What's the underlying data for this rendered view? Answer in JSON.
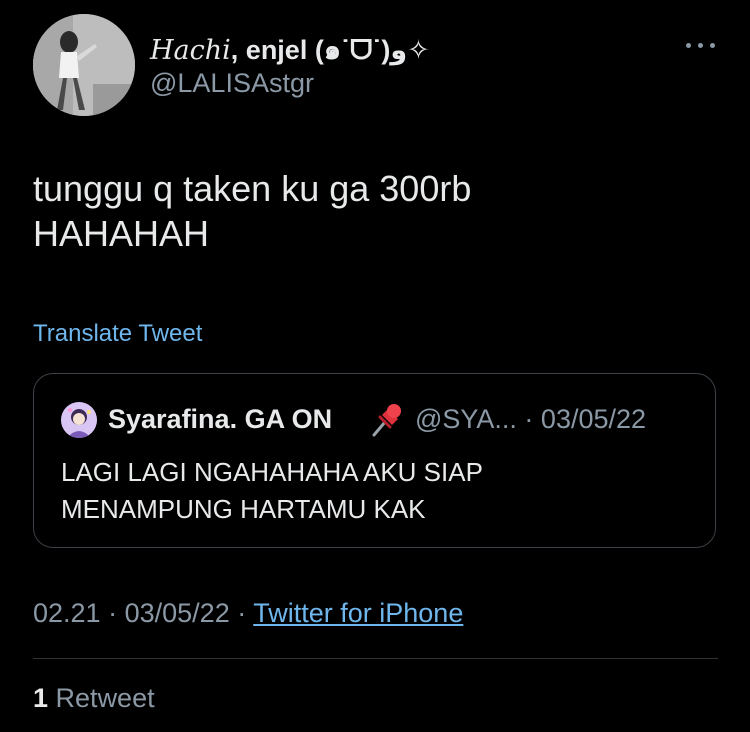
{
  "author": {
    "display_name_fancy": "𝐻𝑎𝑐ℎ𝑖",
    "display_name_rest": ", enjel (๑˙ᗜ˙)و✧",
    "handle": "@LALISAstgr",
    "avatar_icon": "profile-photo"
  },
  "tweet": {
    "text_line1": "tunggu q taken ku ga 300rb",
    "text_line2": "HAHAHAH",
    "translate_label": "Translate Tweet",
    "time": "02.21",
    "separator": "·",
    "date": "03/05/22",
    "source": "Twitter for iPhone"
  },
  "quoted_tweet": {
    "author_name": "Syarafina. GA ON",
    "pin_icon": "pushpin-icon",
    "handle_and_date": "@SYA... · 03/05/22",
    "text_line1": "LAGI LAGI NGAHAHAHA AKU SIAP",
    "text_line2": "MENAMPUNG HARTAMU KAK"
  },
  "stats": {
    "retweet_count": "1",
    "retweet_label": "Retweet"
  },
  "colors": {
    "background": "#000000",
    "text_primary": "#e7e9ea",
    "text_secondary": "#8b98a5",
    "link": "#6fb6ec",
    "border": "#3b4046"
  }
}
